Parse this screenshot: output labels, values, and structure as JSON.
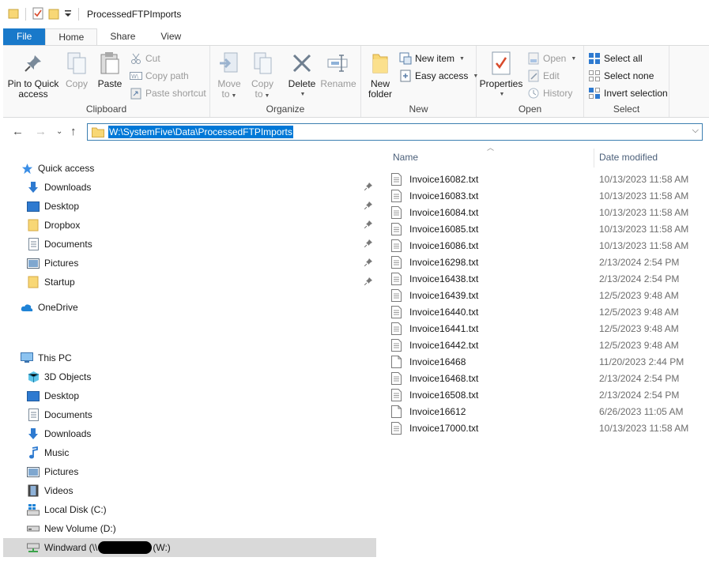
{
  "window": {
    "title": "ProcessedFTPImports"
  },
  "tabs": [
    {
      "label": "File"
    },
    {
      "label": "Home"
    },
    {
      "label": "Share"
    },
    {
      "label": "View"
    }
  ],
  "ribbon": {
    "clipboard": {
      "label": "Clipboard",
      "pin_line1": "Pin to Quick",
      "pin_line2": "access",
      "copy": "Copy",
      "paste": "Paste",
      "cut": "Cut",
      "copy_path": "Copy path",
      "paste_shortcut": "Paste shortcut"
    },
    "organize": {
      "label": "Organize",
      "move_line1": "Move",
      "move_line2": "to",
      "copy_line1": "Copy",
      "copy_line2": "to",
      "delete": "Delete",
      "rename": "Rename"
    },
    "new": {
      "label": "New",
      "folder_line1": "New",
      "folder_line2": "folder",
      "new_item": "New item",
      "easy_access": "Easy access"
    },
    "open": {
      "label": "Open",
      "properties": "Properties",
      "open": "Open",
      "edit": "Edit",
      "history": "History"
    },
    "select": {
      "label": "Select",
      "select_all": "Select all",
      "select_none": "Select none",
      "invert": "Invert selection"
    }
  },
  "address": {
    "path": "W:\\SystemFive\\Data\\ProcessedFTPImports"
  },
  "sidebar": {
    "quick_access": "Quick access",
    "quick_items": [
      {
        "label": "Downloads"
      },
      {
        "label": "Desktop"
      },
      {
        "label": "Dropbox"
      },
      {
        "label": "Documents"
      },
      {
        "label": "Pictures"
      },
      {
        "label": "Startup"
      }
    ],
    "onedrive": "OneDrive",
    "this_pc": "This PC",
    "pc_items": [
      {
        "label": "3D Objects"
      },
      {
        "label": "Desktop"
      },
      {
        "label": "Documents"
      },
      {
        "label": "Downloads"
      },
      {
        "label": "Music"
      },
      {
        "label": "Pictures"
      },
      {
        "label": "Videos"
      },
      {
        "label": "Local Disk (C:)"
      },
      {
        "label": "New Volume (D:)"
      }
    ],
    "network_drive": {
      "prefix": "Windward (\\\\",
      "suffix": "(W:)"
    }
  },
  "columns": {
    "name": "Name",
    "date": "Date modified"
  },
  "files": [
    {
      "name": "Invoice16082.txt",
      "date": "10/13/2023 11:58 AM"
    },
    {
      "name": "Invoice16083.txt",
      "date": "10/13/2023 11:58 AM"
    },
    {
      "name": "Invoice16084.txt",
      "date": "10/13/2023 11:58 AM"
    },
    {
      "name": "Invoice16085.txt",
      "date": "10/13/2023 11:58 AM"
    },
    {
      "name": "Invoice16086.txt",
      "date": "10/13/2023 11:58 AM"
    },
    {
      "name": "Invoice16298.txt",
      "date": "2/13/2024 2:54 PM"
    },
    {
      "name": "Invoice16438.txt",
      "date": "2/13/2024 2:54 PM"
    },
    {
      "name": "Invoice16439.txt",
      "date": "12/5/2023 9:48 AM"
    },
    {
      "name": "Invoice16440.txt",
      "date": "12/5/2023 9:48 AM"
    },
    {
      "name": "Invoice16441.txt",
      "date": "12/5/2023 9:48 AM"
    },
    {
      "name": "Invoice16442.txt",
      "date": "12/5/2023 9:48 AM"
    },
    {
      "name": "Invoice16468",
      "date": "11/20/2023 2:44 PM"
    },
    {
      "name": "Invoice16468.txt",
      "date": "2/13/2024 2:54 PM"
    },
    {
      "name": "Invoice16508.txt",
      "date": "2/13/2024 2:54 PM"
    },
    {
      "name": "Invoice16612",
      "date": "6/26/2023 11:05 AM"
    },
    {
      "name": "Invoice17000.txt",
      "date": "10/13/2023 11:58 AM"
    }
  ],
  "colors": {
    "accent": "#1979ca",
    "selection": "#0078d7",
    "folder": "#f8d775",
    "column_header": "#4c607a"
  }
}
